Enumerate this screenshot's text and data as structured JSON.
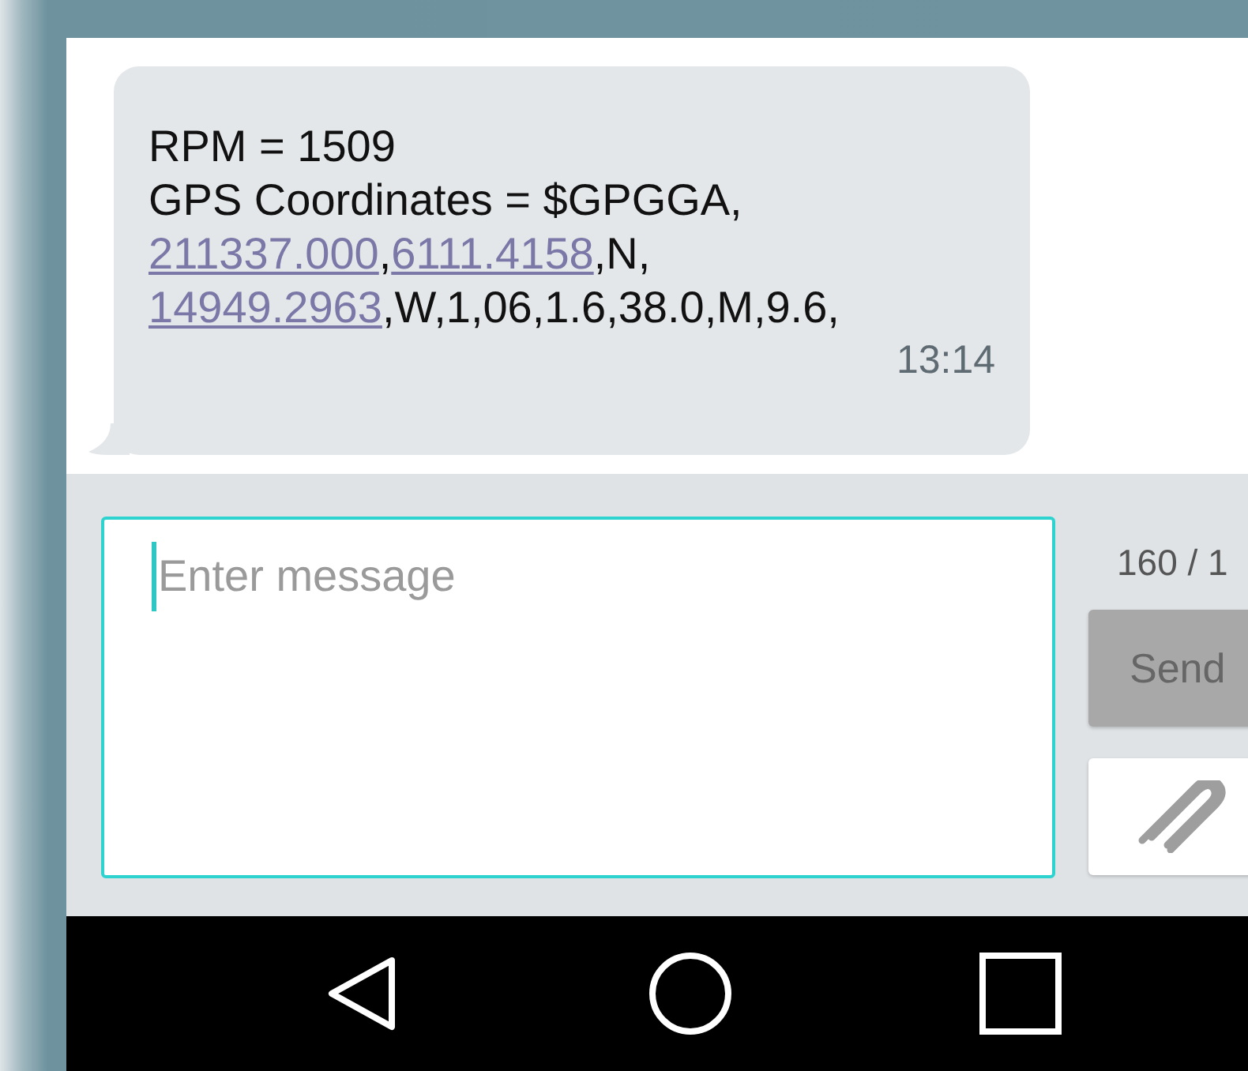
{
  "message": {
    "lines": [
      [
        {
          "kind": "plain",
          "text": "RPM = 1509"
        }
      ],
      [
        {
          "kind": "plain",
          "text": "GPS Coordinates = $GPGGA,"
        }
      ],
      [
        {
          "kind": "link",
          "text": "211337.000"
        },
        {
          "kind": "plain",
          "text": ","
        },
        {
          "kind": "link",
          "text": "6111.4158"
        },
        {
          "kind": "plain",
          "text": ",N,"
        }
      ],
      [
        {
          "kind": "link",
          "text": "14949.2963"
        },
        {
          "kind": "plain",
          "text": ",W,1,06,1.6,38.0,M,9.6,"
        }
      ]
    ],
    "time": "13:14"
  },
  "composer": {
    "placeholder": "Enter message",
    "counter": "160 / 1",
    "send": {
      "label": "Send",
      "disabled": true
    }
  }
}
